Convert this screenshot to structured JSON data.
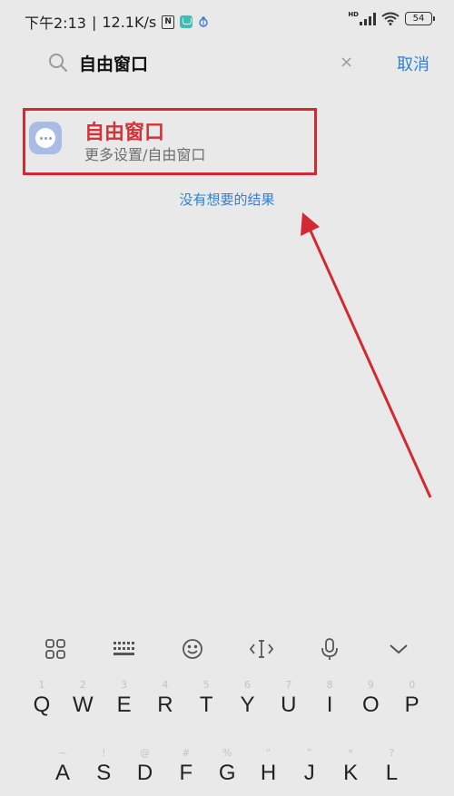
{
  "status_bar": {
    "time": "下午2:13",
    "network_speed": "12.1K/s",
    "nfc_label": "N",
    "hd_label": "HD",
    "battery": "54"
  },
  "search": {
    "query": "自由窗口",
    "cancel_label": "取消",
    "clear_glyph": "×"
  },
  "result": {
    "title": "自由窗口",
    "path": "更多设置/自由窗口"
  },
  "no_result_link": "没有想要的结果",
  "keyboard": {
    "toolbar": [
      "grid-icon",
      "keyboard-icon",
      "emoji-icon",
      "cursor-icon",
      "mic-icon",
      "collapse-icon"
    ],
    "row1": [
      {
        "key": "Q",
        "hint": "1"
      },
      {
        "key": "W",
        "hint": "2"
      },
      {
        "key": "E",
        "hint": "3"
      },
      {
        "key": "R",
        "hint": "4"
      },
      {
        "key": "T",
        "hint": "5"
      },
      {
        "key": "Y",
        "hint": "6"
      },
      {
        "key": "U",
        "hint": "7"
      },
      {
        "key": "I",
        "hint": "8"
      },
      {
        "key": "O",
        "hint": "9"
      },
      {
        "key": "P",
        "hint": "0"
      }
    ],
    "row2": [
      {
        "key": "A",
        "hint": "~"
      },
      {
        "key": "S",
        "hint": "!"
      },
      {
        "key": "D",
        "hint": "@"
      },
      {
        "key": "F",
        "hint": "#"
      },
      {
        "key": "G",
        "hint": "%"
      },
      {
        "key": "H",
        "hint": "“"
      },
      {
        "key": "J",
        "hint": "”"
      },
      {
        "key": "K",
        "hint": "*"
      },
      {
        "key": "L",
        "hint": "?"
      }
    ]
  },
  "colors": {
    "accent": "#2d82d8",
    "highlight": "#d22a30",
    "background": "#e9e9e9"
  }
}
